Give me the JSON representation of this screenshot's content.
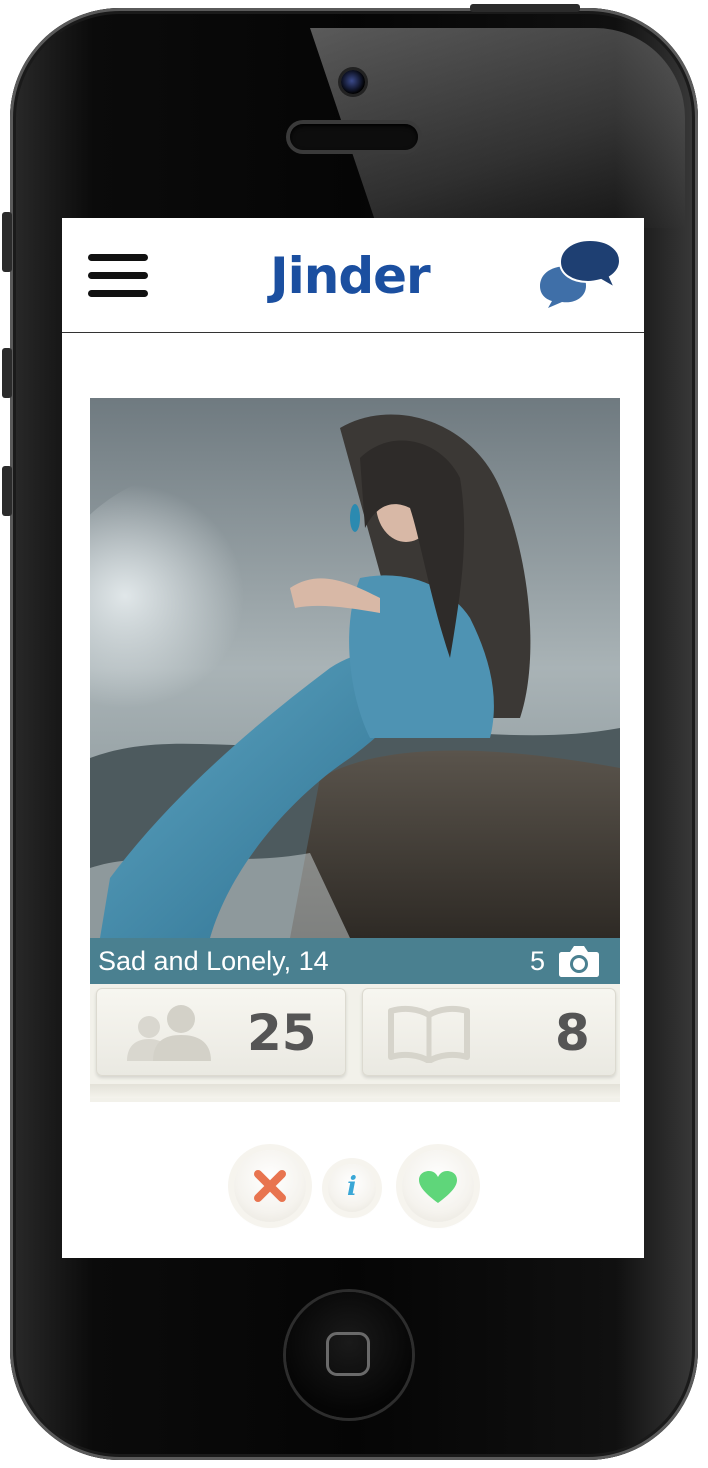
{
  "app": {
    "logo_text": "Jinder",
    "brand_color": "#1b4fa0"
  },
  "header": {
    "menu_icon": "hamburger-menu-icon",
    "chat_icon": "chat-bubbles-icon"
  },
  "profile": {
    "name_age": "Sad and Lonely, 14",
    "photo_count": "5",
    "photo_icon": "camera-icon",
    "name_bar_color": "#4a8090"
  },
  "stats": {
    "friends_icon": "people-icon",
    "friends_count": "25",
    "interests_icon": "book-icon",
    "interests_count": "8"
  },
  "actions": {
    "dislike_icon": "x-icon",
    "info_icon": "info-icon",
    "info_label": "i",
    "like_icon": "heart-icon"
  }
}
